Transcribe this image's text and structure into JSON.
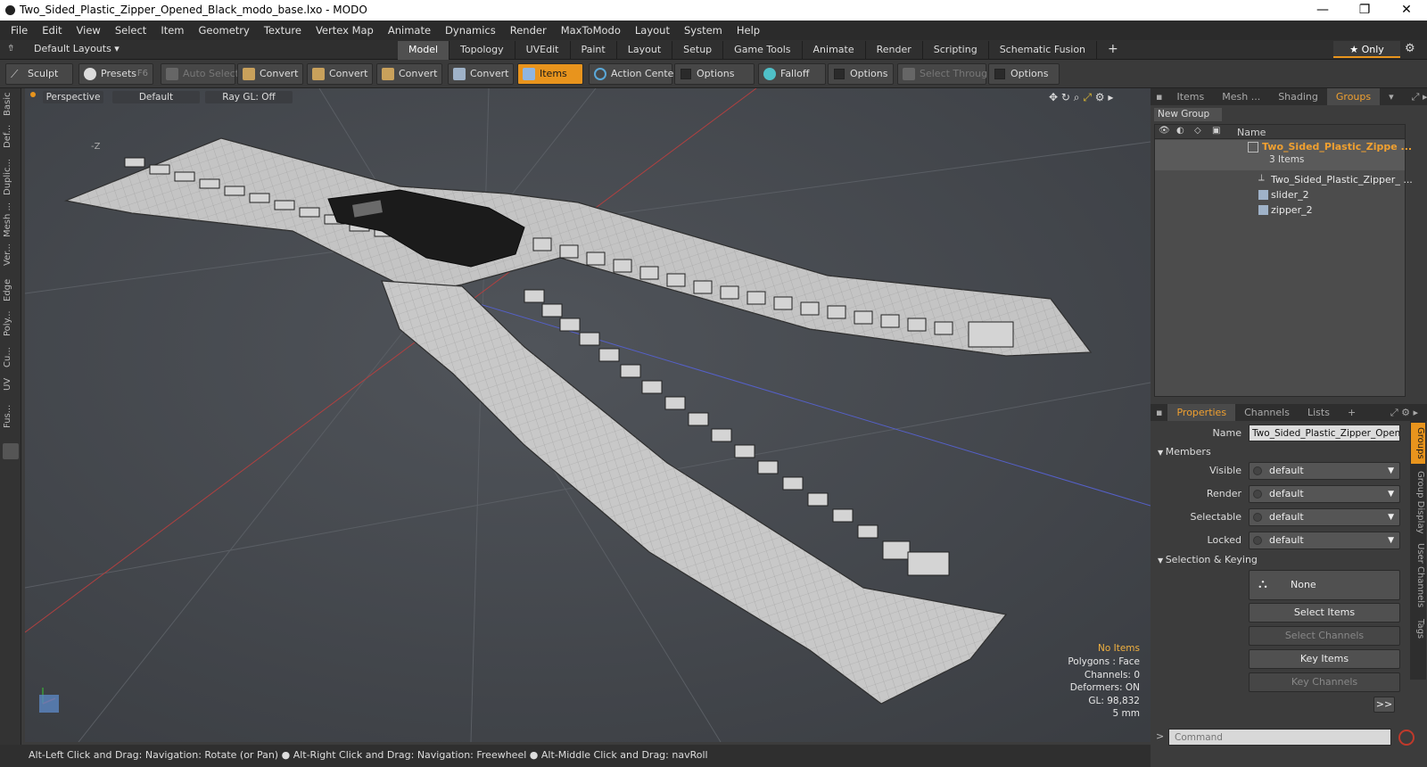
{
  "window": {
    "title": "Two_Sided_Plastic_Zipper_Opened_Black_modo_base.lxo - MODO",
    "controls": [
      "—",
      "❐",
      "✕"
    ]
  },
  "menu": [
    "File",
    "Edit",
    "View",
    "Select",
    "Item",
    "Geometry",
    "Texture",
    "Vertex Map",
    "Animate",
    "Dynamics",
    "Render",
    "MaxToModo",
    "Layout",
    "System",
    "Help"
  ],
  "layoutbar": {
    "default_layouts": "Default Layouts ▾",
    "tabs": [
      "Model",
      "Topology",
      "UVEdit",
      "Paint",
      "Layout",
      "Setup",
      "Game Tools",
      "Animate",
      "Render",
      "Scripting",
      "Schematic Fusion"
    ],
    "active_tab": "Model",
    "add": "+",
    "only": "★  Only"
  },
  "toolbar": {
    "sculpt": "Sculpt",
    "presets": "Presets",
    "presets_key": "F6",
    "auto_select": "Auto Select",
    "convert1": "Convert",
    "convert2": "Convert",
    "convert3": "Convert",
    "convert4": "Convert",
    "items": "Items",
    "action_center": "Action Center",
    "options1": "Options",
    "falloff": "Falloff",
    "options2": "Options",
    "select_through": "Select Through",
    "options3": "Options"
  },
  "leftstrip": [
    "Basic",
    "Def...",
    "Duplic...",
    "Mesh ...",
    "Ver...",
    "Edge",
    "Poly...",
    "Cu...",
    "UV",
    "Fus..."
  ],
  "viewport": {
    "view": "Perspective",
    "shading": "Default",
    "raygl": "Ray GL: Off",
    "axis_label": "-Z",
    "stats": {
      "selection": "No Items",
      "polygons": "Polygons : Face",
      "channels": "Channels: 0",
      "deformers": "Deformers: ON",
      "gl": "GL: 98,832",
      "scale": "5 mm"
    }
  },
  "statusbar": "Alt-Left Click and Drag: Navigation: Rotate (or Pan) ● Alt-Right Click and Drag: Navigation: Freewheel ● Alt-Middle Click and Drag: navRoll",
  "panel": {
    "tabs": [
      "Items",
      "Mesh ...",
      "Shading",
      "Groups"
    ],
    "active_tab": "Groups",
    "new_group": "New Group",
    "col_name": "Name",
    "group_name": "Two_Sided_Plastic_Zippe ...",
    "group_count": "3 Items",
    "children": [
      "Two_Sided_Plastic_Zipper_ ...",
      "slider_2",
      "zipper_2"
    ],
    "prop_tabs": [
      "Properties",
      "Channels",
      "Lists",
      "+"
    ],
    "name_label": "Name",
    "name_value": "Two_Sided_Plastic_Zipper_Opene",
    "members": "Members",
    "visible_label": "Visible",
    "render_label": "Render",
    "selectable_label": "Selectable",
    "locked_label": "Locked",
    "default": "default",
    "selection_keying": "Selection & Keying",
    "none": "None",
    "select_items": "Select Items",
    "select_channels": "Select Channels",
    "key_items": "Key Items",
    "key_channels": "Key Channels",
    "more": ">>",
    "vtabs": [
      "Groups",
      "Group Display",
      "User Channels",
      "Tags"
    ],
    "command_placeholder": "Command"
  },
  "colors": {
    "accent": "#e8941d",
    "viewport": "#474a4f"
  }
}
